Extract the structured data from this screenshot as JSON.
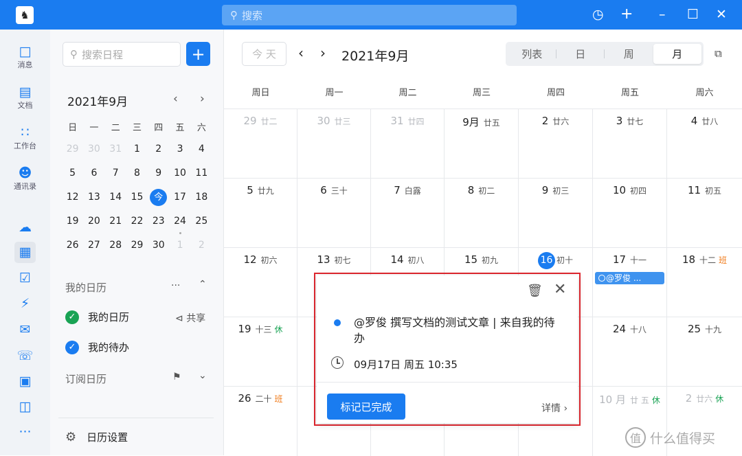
{
  "titlebar": {
    "search_placeholder": "搜索",
    "icons": [
      "history-icon",
      "plus-icon",
      "minimize-icon",
      "maximize-icon",
      "close-icon"
    ]
  },
  "rail": {
    "items": [
      {
        "label": "消息",
        "icon": "message-icon"
      },
      {
        "label": "文档",
        "icon": "document-icon"
      },
      {
        "label": "工作台",
        "icon": "workbench-icon"
      },
      {
        "label": "通讯录",
        "icon": "contacts-icon"
      }
    ],
    "more": "···"
  },
  "sidebar": {
    "search_placeholder": "搜索日程",
    "add_label": "+",
    "mini_title": "2021年9月",
    "weekdays": [
      "日",
      "一",
      "二",
      "三",
      "四",
      "五",
      "六"
    ],
    "weeks": [
      [
        "29",
        "30",
        "31",
        "1",
        "2",
        "3",
        "4"
      ],
      [
        "5",
        "6",
        "7",
        "8",
        "9",
        "10",
        "11"
      ],
      [
        "12",
        "13",
        "14",
        "15",
        "今",
        "17",
        "18"
      ],
      [
        "19",
        "20",
        "21",
        "22",
        "23",
        "24",
        "25"
      ],
      [
        "26",
        "27",
        "28",
        "29",
        "30",
        "1",
        "2"
      ]
    ],
    "my_calendars_label": "我的日历",
    "my_calendars_more": "···",
    "my_calendar": "我的日历",
    "share_label": "共享",
    "my_todo": "我的待办",
    "subscribed_label": "订阅日历",
    "settings_label": "日历设置"
  },
  "main": {
    "today_label": "今 天",
    "prev": "‹",
    "next": "›",
    "title": "2021年9月",
    "view_tabs": [
      "列表",
      "日",
      "周",
      "月"
    ],
    "weekdays": [
      "周日",
      "周一",
      "周二",
      "周三",
      "周四",
      "周五",
      "周六"
    ],
    "rows": [
      [
        {
          "d": "29",
          "l": "廿二"
        },
        {
          "d": "30",
          "l": "廿三"
        },
        {
          "d": "31",
          "l": "廿四"
        },
        {
          "d": "9月",
          "l": "廿五"
        },
        {
          "d": "2",
          "l": "廿六"
        },
        {
          "d": "3",
          "l": "廿七"
        },
        {
          "d": "4",
          "l": "廿八"
        }
      ],
      [
        {
          "d": "5",
          "l": "廿九"
        },
        {
          "d": "6",
          "l": "三十"
        },
        {
          "d": "7",
          "l": "白露"
        },
        {
          "d": "8",
          "l": "初二"
        },
        {
          "d": "9",
          "l": "初三"
        },
        {
          "d": "10",
          "l": "初四"
        },
        {
          "d": "11",
          "l": "初五"
        }
      ],
      [
        {
          "d": "12",
          "l": "初六"
        },
        {
          "d": "13",
          "l": "初七"
        },
        {
          "d": "14",
          "l": "初八"
        },
        {
          "d": "15",
          "l": "初九"
        },
        {
          "d": "16",
          "l": "初十"
        },
        {
          "d": "17",
          "l": "十一"
        },
        {
          "d": "18",
          "l": "十二",
          "b": "班"
        }
      ],
      [
        {
          "d": "19",
          "l": "十三",
          "r": "休"
        },
        {
          "d": "",
          "l": ""
        },
        {
          "d": "",
          "l": ""
        },
        {
          "d": "",
          "l": ""
        },
        {
          "d": "",
          "l": ""
        },
        {
          "d": "24",
          "l": "十八"
        },
        {
          "d": "25",
          "l": "十九"
        }
      ],
      [
        {
          "d": "26",
          "l": "二十",
          "b": "班"
        },
        {
          "d": "",
          "l": ""
        },
        {
          "d": "",
          "l": ""
        },
        {
          "d": "",
          "l": ""
        },
        {
          "d": "",
          "l": ""
        },
        {
          "d": "10 月",
          "l": "廿 五",
          "r": "休"
        },
        {
          "d": "2",
          "l": "廿六",
          "r": "休"
        }
      ]
    ],
    "event_chip": "@罗俊 ..."
  },
  "popup": {
    "title": "@罗俊 撰写文档的测试文章 | 来自我的待办",
    "time": "09月17日 周五 10:35",
    "done_label": "标记已完成",
    "detail_label": "详情",
    "detail_arrow": "›"
  },
  "watermark": {
    "logo": "值",
    "text": "什么值得买"
  },
  "colors": {
    "brand": "#1a7cf0",
    "work": "#f07b1a",
    "rest": "#19a354",
    "highlight_border": "#e0262e"
  }
}
